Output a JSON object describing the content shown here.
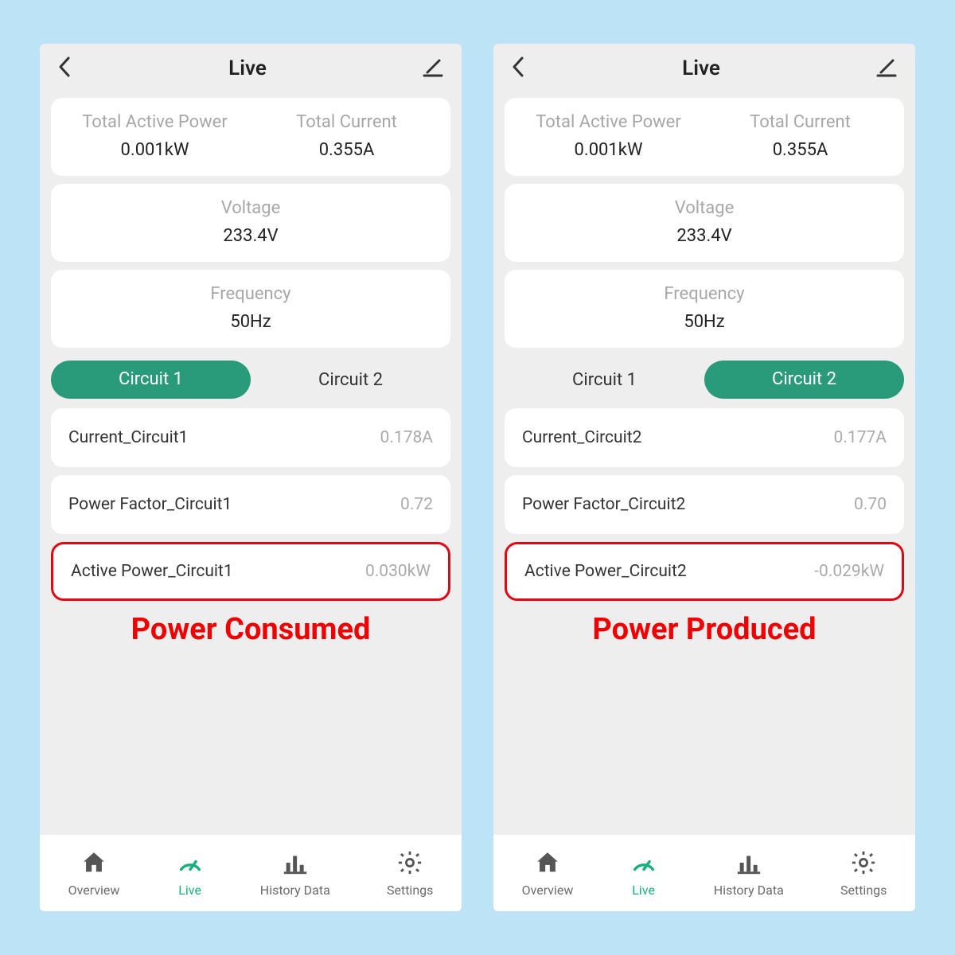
{
  "left": {
    "header": {
      "title": "Live"
    },
    "summary": {
      "total_active_power_label": "Total Active Power",
      "total_active_power_value": "0.001kW",
      "total_current_label": "Total Current",
      "total_current_value": "0.355A",
      "voltage_label": "Voltage",
      "voltage_value": "233.4V",
      "frequency_label": "Frequency",
      "frequency_value": "50Hz"
    },
    "tabs": {
      "circuit1": "Circuit 1",
      "circuit2": "Circuit 2"
    },
    "rows": {
      "current_label": "Current_Circuit1",
      "current_value": "0.178A",
      "pf_label": "Power Factor_Circuit1",
      "pf_value": "0.72",
      "ap_label": "Active Power_Circuit1",
      "ap_value": "0.030kW"
    },
    "annotation": "Power Consumed",
    "nav": {
      "overview": "Overview",
      "live": "Live",
      "history": "History Data",
      "settings": "Settings"
    }
  },
  "right": {
    "header": {
      "title": "Live"
    },
    "summary": {
      "total_active_power_label": "Total Active Power",
      "total_active_power_value": "0.001kW",
      "total_current_label": "Total Current",
      "total_current_value": "0.355A",
      "voltage_label": "Voltage",
      "voltage_value": "233.4V",
      "frequency_label": "Frequency",
      "frequency_value": "50Hz"
    },
    "tabs": {
      "circuit1": "Circuit 1",
      "circuit2": "Circuit 2"
    },
    "rows": {
      "current_label": "Current_Circuit2",
      "current_value": "0.177A",
      "pf_label": "Power Factor_Circuit2",
      "pf_value": "0.70",
      "ap_label": "Active Power_Circuit2",
      "ap_value": "-0.029kW"
    },
    "annotation": "Power Produced",
    "nav": {
      "overview": "Overview",
      "live": "Live",
      "history": "History Data",
      "settings": "Settings"
    }
  }
}
